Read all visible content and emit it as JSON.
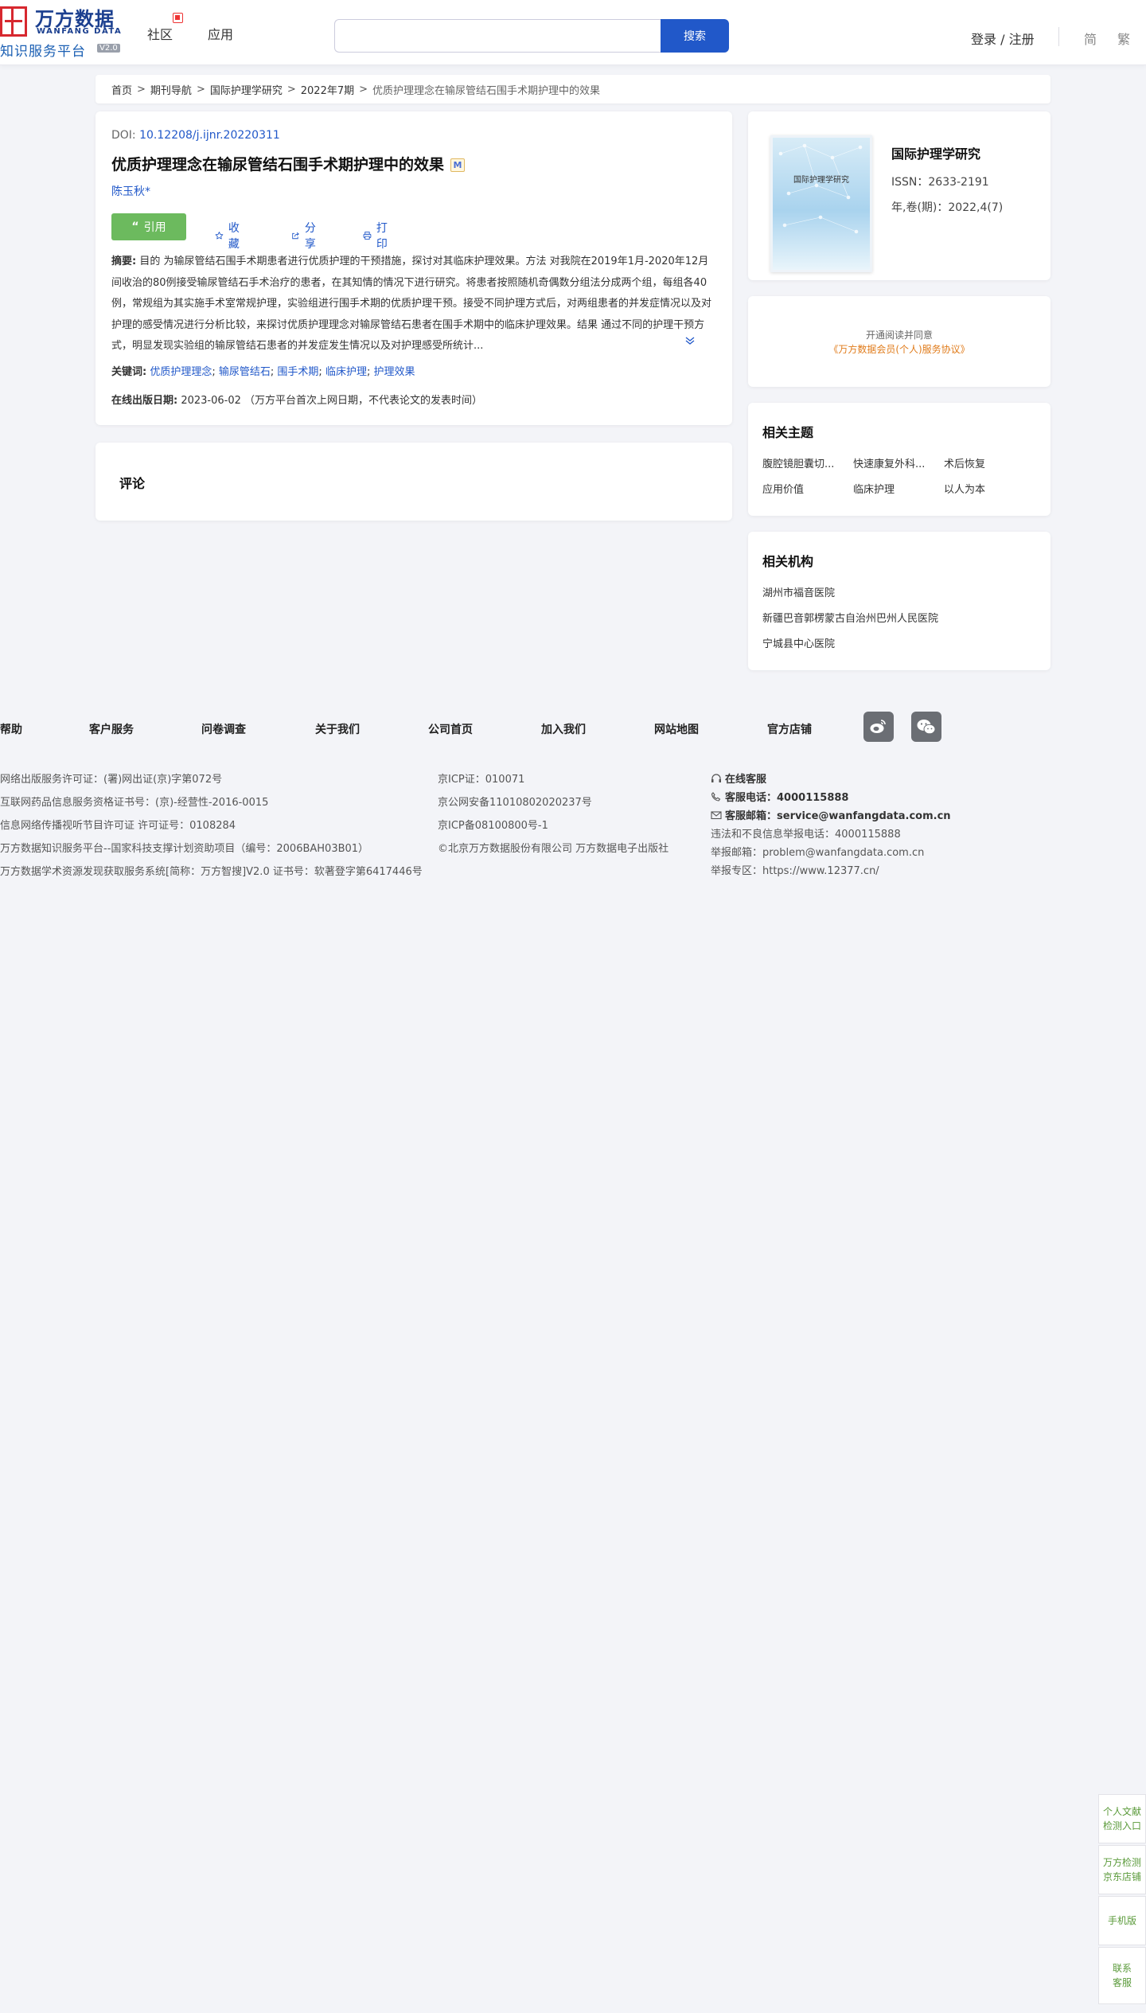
{
  "header": {
    "logo_cn": "万方数据",
    "logo_en": "WANFANG DATA",
    "logo_sub": "知识服务平台",
    "logo_ver": "V2.0",
    "nav": [
      "社区",
      "应用"
    ],
    "search_value": "",
    "search_button": "搜索",
    "login": "登录 / 注册",
    "lang_simplified": "简",
    "lang_traditional": "繁"
  },
  "breadcrumb": {
    "items": [
      "首页",
      "期刊导航",
      "国际护理学研究",
      "2022年7期"
    ],
    "current": "优质护理理念在输尿管结石围手术期护理中的效果",
    "separator": ">"
  },
  "article": {
    "doi_label": "DOI:",
    "doi": "10.12208/j.ijnr.20220311",
    "title": "优质护理理念在输尿管结石围手术期护理中的效果",
    "title_badge": "M",
    "author": "陈玉秋*",
    "actions": {
      "cite": "引用",
      "favorite": "收藏",
      "share": "分享",
      "print": "打印"
    },
    "abstract_label": "摘要:",
    "abstract": "目的 为输尿管结石围手术期患者进行优质护理的干预措施，探讨对其临床护理效果。方法 对我院在2019年1月-2020年12月间收治的80例接受输尿管结石手术治疗的患者，在其知情的情况下进行研究。将患者按照随机奇偶数分组法分成两个组，每组各40例，常规组为其实施手术室常规护理，实验组进行围手术期的优质护理干预。接受不同护理方式后，对两组患者的并发症情况以及对护理的感受情况进行分析比较，来探讨优质护理理念对输尿管结石患者在围手术期中的临床护理效果。结果 通过不同的护理干预方式，明显发现实验组的输尿管结石患者的并发症发生情况以及对护理感受所统计...",
    "keywords_label": "关键词:",
    "keywords": [
      "优质护理理念",
      "输尿管结石",
      "围手术期",
      "临床护理",
      "护理效果"
    ],
    "pubdate_label": "在线出版日期:",
    "pubdate": "2023-06-02",
    "pubdate_note": "（万方平台首次上网日期，不代表论文的发表时间）"
  },
  "comments": {
    "title": "评论"
  },
  "journal": {
    "cover_title": "国际护理学研究",
    "name": "国际护理学研究",
    "issn": "ISSN：2633-2191",
    "year_issue": "年,卷(期)：2022,4(7)"
  },
  "open_access": {
    "text": "开通阅读并同意",
    "link": "《万方数据会员(个人)服务协议》"
  },
  "related_topics": {
    "title": "相关主题",
    "items": [
      "腹腔镜胆囊切...",
      "快速康复外科...",
      "术后恢复",
      "应用价值",
      "临床护理",
      "以人为本"
    ]
  },
  "related_orgs": {
    "title": "相关机构",
    "items": [
      "湖州市福音医院",
      "新疆巴音郭楞蒙古自治州巴州人民医院",
      "宁城县中心医院"
    ]
  },
  "footer": {
    "links": [
      "帮助",
      "客户服务",
      "问卷调查",
      "关于我们",
      "公司首页",
      "加入我们",
      "网站地图",
      "官方店铺"
    ],
    "col1": [
      "网络出版服务许可证：(署)网出证(京)字第072号",
      "互联网药品信息服务资格证书号：(京)-经营性-2016-0015",
      "信息网络传播视听节目许可证 许可证号：0108284",
      "万方数据知识服务平台--国家科技支撑计划资助项目（编号：2006BAH03B01）",
      "万方数据学术资源发现获取服务系统[简称：万方智搜]V2.0 证书号：软著登字第6417446号"
    ],
    "col2": [
      "京ICP证：010071",
      "京公网安备11010802020237号",
      "京ICP备08100800号-1",
      "©北京万方数据股份有限公司 万方数据电子出版社"
    ],
    "online_service": "在线客服",
    "phone_label": "客服电话：",
    "phone": "4000115888",
    "email_label": "客服邮箱：",
    "email": "service@wanfangdata.com.cn",
    "report_phone": "违法和不良信息举报电话：4000115888",
    "report_email": "举报邮箱：problem@wanfangdata.com.cn",
    "report_zone": "举报专区：https://www.12377.cn/"
  },
  "float_side": {
    "items": [
      "个人文献检测入口",
      "万方检测京东店铺",
      "手机版",
      "联系客服"
    ]
  }
}
